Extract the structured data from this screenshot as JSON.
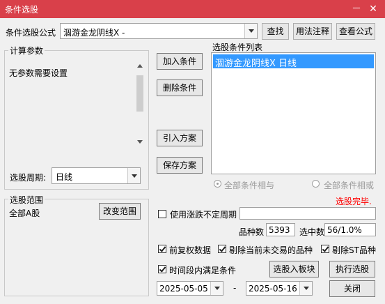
{
  "window": {
    "title": "条件选股",
    "minimize_glyph": "－",
    "close_glyph": "✕"
  },
  "formula": {
    "label": "条件选股公式",
    "value": "涸游金龙阴线X -"
  },
  "buttons": {
    "find": "查找",
    "usage": "用法注释",
    "view_formula": "查看公式",
    "add_condition": "加入条件",
    "delete_condition": "删除条件",
    "import_plan": "引入方案",
    "save_plan": "保存方案",
    "change_range": "改变范围",
    "select_to_block": "选股入板块",
    "execute": "执行选股",
    "close": "关闭"
  },
  "params": {
    "group_title": "计算参数",
    "message": "无参数需要设置"
  },
  "period": {
    "label": "选股周期:",
    "value": "日线"
  },
  "condition_list": {
    "title": "选股条件列表",
    "items": [
      "涸游金龙阴线X  日线"
    ]
  },
  "logic": {
    "and_label": "全部条件相与",
    "or_label": "全部条件相或"
  },
  "status_text": "选股完毕.",
  "range": {
    "group_title": "选股范围",
    "value": "全部A股"
  },
  "uncertain_period": {
    "label": "使用涨跌不定周期",
    "value": "",
    "checked": false
  },
  "counts": {
    "varieties_label": "品种数",
    "varieties_value": "5393",
    "selected_label": "选中数",
    "selected_value": "56/1.0%"
  },
  "options": {
    "pre_adjust": {
      "label": "前复权数据",
      "checked": true
    },
    "exclude_no_trade": {
      "label": "剔除当前未交易的品种",
      "checked": true
    },
    "exclude_st": {
      "label": "剔除ST品种",
      "checked": true
    },
    "time_range": {
      "label": "时间段内满足条件",
      "checked": true
    }
  },
  "dates": {
    "start": "2025-05-05",
    "separator": "-",
    "end": "2025-05-16"
  },
  "colors": {
    "titlebar": "#d9404a",
    "selection": "#3399ff",
    "status": "#ff0000"
  }
}
